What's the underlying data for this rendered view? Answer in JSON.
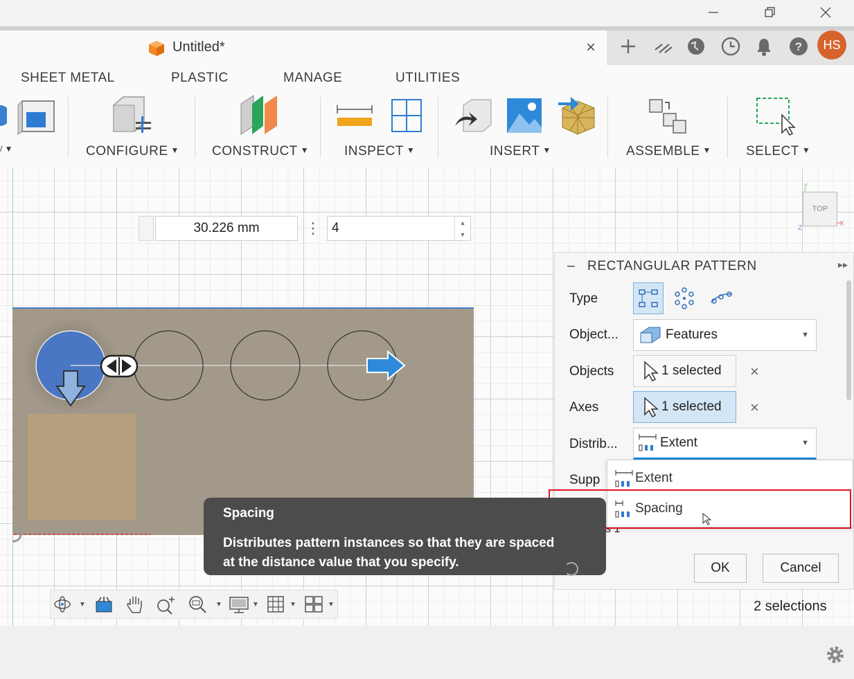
{
  "window": {
    "minimize_icon": "minimize-icon",
    "restore_icon": "restore-icon",
    "close_icon": "close-icon"
  },
  "document": {
    "title": "Untitled*",
    "close_glyph": "×"
  },
  "toolbar_right": {
    "icons": [
      "plus-icon",
      "stack-icon",
      "globe-icon",
      "clock-icon",
      "bell-icon",
      "help-icon"
    ],
    "avatar_initials": "HS"
  },
  "ribbon": {
    "tabs": [
      "SHEET METAL",
      "PLASTIC",
      "MANAGE",
      "UTILITIES"
    ],
    "groups": [
      "CONFIGURE",
      "CONSTRUCT",
      "INSPECT",
      "INSERT",
      "ASSEMBLE",
      "SELECT"
    ],
    "caret": "▼"
  },
  "canvas": {
    "distance_value": "30.226 mm",
    "quantity_value": "4",
    "viewcube_label": "TOP",
    "menu_glyph": "⋮"
  },
  "panel": {
    "title": "RECTANGULAR PATTERN",
    "collapse_glyph": "−",
    "expand_glyph": "▸▸",
    "labels": {
      "type": "Type",
      "object_type": "Object...",
      "objects": "Objects",
      "axes": "Axes",
      "distribution": "Distrib...",
      "suppress": "Supp",
      "partial_hidden": "s 1"
    },
    "object_type_value": "Features",
    "objects_value": "1 selected",
    "axes_value": "1 selected",
    "distribution_value": "Extent",
    "clear_glyph": "×",
    "dropdown_items": [
      "Extent",
      "Spacing"
    ],
    "ok": "OK",
    "cancel": "Cancel",
    "selection_count": "2 selections"
  },
  "tooltip": {
    "title": "Spacing",
    "body_line1": "Distributes pattern instances so that they are spaced",
    "body_line2": "at the distance value that you specify."
  },
  "colors": {
    "accent": "#1f86d4",
    "highlight_border": "#e0141e",
    "avatar": "#d7632c",
    "plate": "#a2998a",
    "tooltip_bg": "#4c4c4c"
  }
}
